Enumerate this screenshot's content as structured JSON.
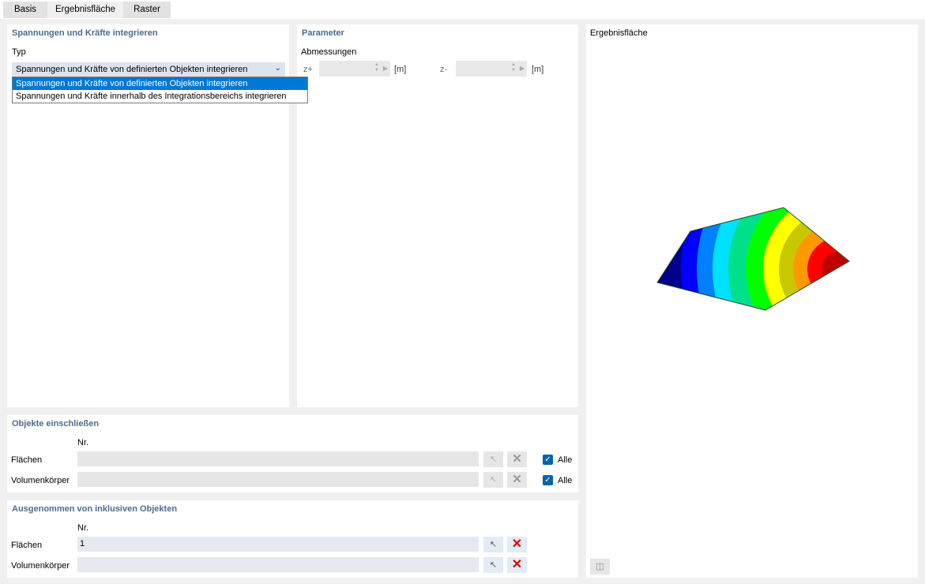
{
  "tabs": [
    {
      "label": "Basis",
      "active": false
    },
    {
      "label": "Ergebnisfläche",
      "active": true
    },
    {
      "label": "Raster",
      "active": false
    }
  ],
  "integrate": {
    "title": "Spannungen und Kräfte integrieren",
    "typ_label": "Typ",
    "selected": "Spannungen und Kräfte von definierten Objekten integrieren",
    "options": [
      "Spannungen und Kräfte von definierten Objekten integrieren",
      "Spannungen und Kräfte innerhalb des Integrationsbereichs integrieren"
    ]
  },
  "parameter": {
    "title": "Parameter",
    "dims_label": "Abmessungen",
    "zplus_label": "z+",
    "zminus_label": "z-",
    "zplus_value": "",
    "zminus_value": "",
    "unit": "[m]"
  },
  "include": {
    "title": "Objekte einschließen",
    "nr_header": "Nr.",
    "rows": [
      {
        "label": "Flächen",
        "value": "",
        "all_label": "Alle",
        "all_checked": true
      },
      {
        "label": "Volumenkörper",
        "value": "",
        "all_label": "Alle",
        "all_checked": true
      }
    ]
  },
  "exclude": {
    "title": "Ausgenommen von inklusiven Objekten",
    "nr_header": "Nr.",
    "rows": [
      {
        "label": "Flächen",
        "value": "1"
      },
      {
        "label": "Volumenkörper",
        "value": ""
      }
    ]
  },
  "preview": {
    "title": "Ergebnisfläche",
    "contour_colors": [
      "#00008b",
      "#0000ff",
      "#0080ff",
      "#00e0ff",
      "#00e08a",
      "#00ff00",
      "#ffff00",
      "#c8c800",
      "#ff9900",
      "#ff0000",
      "#c00000"
    ]
  },
  "icons": {
    "pick": "cursor-pick-icon",
    "clear": "clear-x-icon",
    "checkbox": "check-icon",
    "view_options": "view-options-icon"
  }
}
